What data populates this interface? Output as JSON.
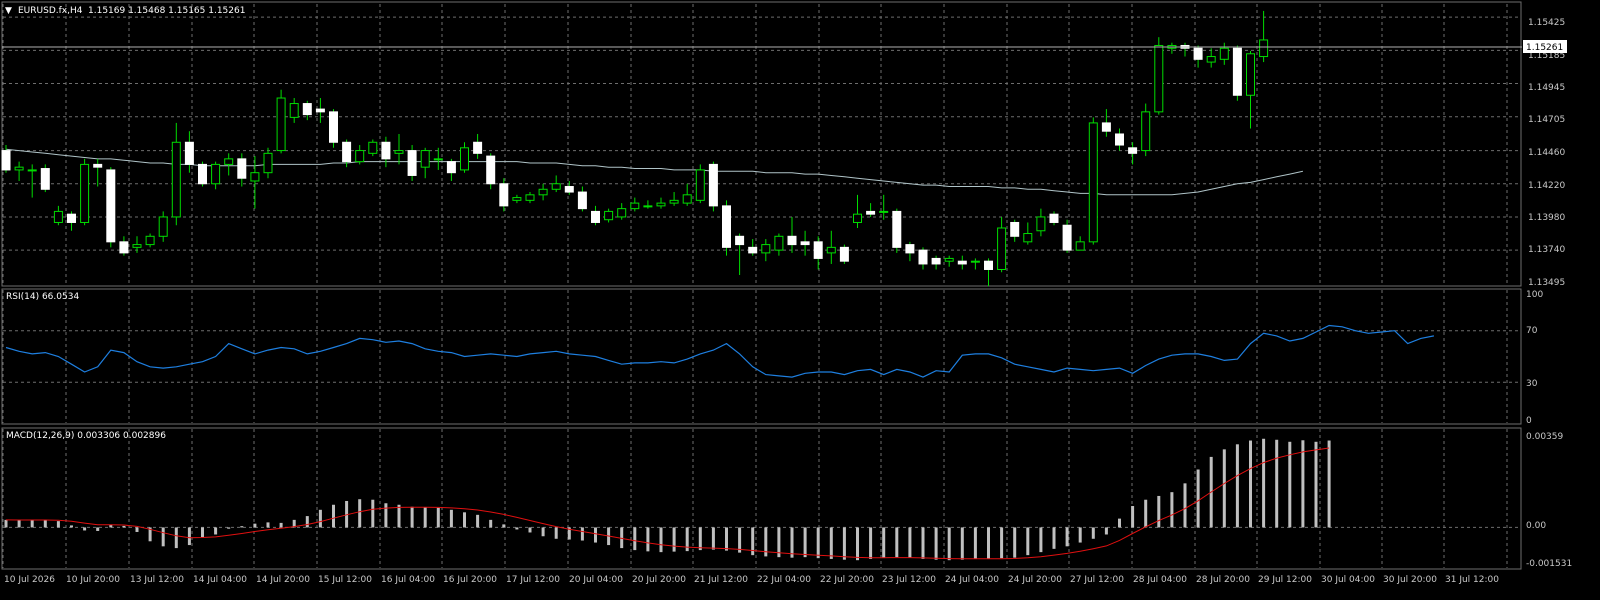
{
  "main": {
    "title_prefix": "▼",
    "symbol": "EURUSD.fx,H4",
    "ohlc": "1.15169 1.15468 1.15165 1.15261",
    "price_axis": [
      "1.15425",
      "1.15185",
      "1.14945",
      "1.14705",
      "1.14460",
      "1.14220",
      "1.13980",
      "1.13740",
      "1.13495"
    ],
    "current_price": "1.15261"
  },
  "rsi": {
    "title": "RSI(14) 66.0534",
    "axis": [
      "100",
      "70",
      "30",
      "0"
    ]
  },
  "macd": {
    "title": "MACD(12,26,9) 0.003306 0.002896",
    "axis": [
      "0.00359",
      "0.00",
      "-0.001531"
    ]
  },
  "time_axis": [
    "10 Jul 2026",
    "10 Jul 20:00",
    "13 Jul 12:00",
    "14 Jul 04:00",
    "14 Jul 20:00",
    "15 Jul 12:00",
    "16 Jul 04:00",
    "16 Jul 20:00",
    "17 Jul 12:00",
    "20 Jul 04:00",
    "20 Jul 20:00",
    "21 Jul 12:00",
    "22 Jul 04:00",
    "22 Jul 20:00",
    "23 Jul 12:00",
    "24 Jul 04:00",
    "24 Jul 20:00",
    "27 Jul 12:00",
    "28 Jul 04:00",
    "28 Jul 20:00",
    "29 Jul 12:00",
    "30 Jul 04:00",
    "30 Jul 20:00",
    "31 Jul 12:00"
  ],
  "colors": {
    "background": "#000000",
    "grid": "#6e6e6e",
    "bull_body": "#000000",
    "bear_body": "#ffffff",
    "wick": "#00dd00",
    "ma": "#b0c4c8",
    "rsi_line": "#1e7fe0",
    "macd_hist": "#c0c0c0",
    "macd_signal": "#e01010",
    "price_box_bg": "#ffffff"
  },
  "chart_data": [
    {
      "type": "candlestick",
      "title": "EURUSD.fx,H4",
      "ylim": [
        1.13495,
        1.1552
      ],
      "moving_average": [
        1.1447,
        1.1446,
        1.1445,
        1.1444,
        1.1443,
        1.1442,
        1.1441,
        1.144,
        1.144,
        1.1439,
        1.1438,
        1.1437,
        1.1437,
        1.1436,
        1.1436,
        1.1435,
        1.1435,
        1.1435,
        1.1435,
        1.1435,
        1.1436,
        1.1436,
        1.1436,
        1.1436,
        1.1436,
        1.1437,
        1.1437,
        1.1438,
        1.1438,
        1.1438,
        1.1438,
        1.1438,
        1.1438,
        1.1438,
        1.1438,
        1.1438,
        1.1438,
        1.1438,
        1.1438,
        1.1438,
        1.1437,
        1.1437,
        1.1437,
        1.1436,
        1.1435,
        1.1435,
        1.1434,
        1.1434,
        1.1433,
        1.1433,
        1.1433,
        1.1432,
        1.1432,
        1.1432,
        1.1431,
        1.1431,
        1.1431,
        1.1431,
        1.143,
        1.143,
        1.143,
        1.1429,
        1.1429,
        1.1428,
        1.1427,
        1.1426,
        1.1425,
        1.1424,
        1.1423,
        1.1422,
        1.1421,
        1.1421,
        1.142,
        1.142,
        1.142,
        1.142,
        1.1419,
        1.1419,
        1.1418,
        1.1418,
        1.1417,
        1.1416,
        1.1415,
        1.1415,
        1.1414,
        1.1414,
        1.1414,
        1.1414,
        1.1414,
        1.1414,
        1.1415,
        1.1416,
        1.1418,
        1.142,
        1.1422,
        1.1423,
        1.1425,
        1.1427,
        1.1429,
        1.1431
      ],
      "candles": [
        [
          1.1446,
          1.1432,
          1.145,
          1.143
        ],
        [
          1.1432,
          1.1434,
          1.1438,
          1.1424
        ],
        [
          1.1432,
          1.1432,
          1.1436,
          1.1412
        ],
        [
          1.1433,
          1.1418,
          1.1436,
          1.1416
        ],
        [
          1.1394,
          1.1402,
          1.1406,
          1.1392
        ],
        [
          1.14,
          1.1394,
          1.1402,
          1.1388
        ],
        [
          1.1394,
          1.1436,
          1.144,
          1.1392
        ],
        [
          1.1436,
          1.1434,
          1.144,
          1.142
        ],
        [
          1.1432,
          1.138,
          1.1434,
          1.1376
        ],
        [
          1.138,
          1.1372,
          1.1384,
          1.137
        ],
        [
          1.1376,
          1.1378,
          1.1384,
          1.1372
        ],
        [
          1.1378,
          1.1384,
          1.1386,
          1.1376
        ],
        [
          1.1384,
          1.1398,
          1.1402,
          1.138
        ],
        [
          1.1398,
          1.1452,
          1.1466,
          1.1392
        ],
        [
          1.1452,
          1.1436,
          1.146,
          1.143
        ],
        [
          1.1436,
          1.1422,
          1.1438,
          1.142
        ],
        [
          1.1422,
          1.1436,
          1.1438,
          1.1418
        ],
        [
          1.1436,
          1.144,
          1.1444,
          1.1428
        ],
        [
          1.144,
          1.1426,
          1.1444,
          1.142
        ],
        [
          1.1424,
          1.143,
          1.1442,
          1.1404
        ],
        [
          1.143,
          1.1444,
          1.1448,
          1.1426
        ],
        [
          1.1446,
          1.1484,
          1.149,
          1.1444
        ],
        [
          1.147,
          1.148,
          1.1484,
          1.1466
        ],
        [
          1.148,
          1.1472,
          1.1482,
          1.1468
        ],
        [
          1.1476,
          1.1474,
          1.1484,
          1.1466
        ],
        [
          1.1474,
          1.1452,
          1.1476,
          1.1448
        ],
        [
          1.1452,
          1.1438,
          1.1454,
          1.1434
        ],
        [
          1.1438,
          1.1446,
          1.145,
          1.1436
        ],
        [
          1.1444,
          1.1452,
          1.1454,
          1.1442
        ],
        [
          1.1452,
          1.144,
          1.1456,
          1.1434
        ],
        [
          1.1444,
          1.1446,
          1.1458,
          1.1436
        ],
        [
          1.1446,
          1.1428,
          1.145,
          1.1424
        ],
        [
          1.1434,
          1.1446,
          1.1448,
          1.1426
        ],
        [
          1.144,
          1.144,
          1.1448,
          1.1432
        ],
        [
          1.1438,
          1.143,
          1.144,
          1.1424
        ],
        [
          1.1432,
          1.1448,
          1.1452,
          1.143
        ],
        [
          1.1452,
          1.1444,
          1.1458,
          1.144
        ],
        [
          1.1442,
          1.1422,
          1.1444,
          1.1418
        ],
        [
          1.1422,
          1.1406,
          1.1426,
          1.1402
        ],
        [
          1.141,
          1.1412,
          1.1414,
          1.1408
        ],
        [
          1.141,
          1.1414,
          1.1416,
          1.1408
        ],
        [
          1.1414,
          1.1418,
          1.1422,
          1.141
        ],
        [
          1.1418,
          1.1422,
          1.1428,
          1.1416
        ],
        [
          1.142,
          1.1416,
          1.1424,
          1.1414
        ],
        [
          1.1416,
          1.1404,
          1.142,
          1.1402
        ],
        [
          1.1402,
          1.1394,
          1.1406,
          1.1392
        ],
        [
          1.1396,
          1.1402,
          1.1404,
          1.1394
        ],
        [
          1.1398,
          1.1404,
          1.1408,
          1.1396
        ],
        [
          1.1404,
          1.1408,
          1.1412,
          1.1402
        ],
        [
          1.1406,
          1.1406,
          1.141,
          1.1404
        ],
        [
          1.1406,
          1.1408,
          1.1412,
          1.1404
        ],
        [
          1.1408,
          1.141,
          1.1416,
          1.1406
        ],
        [
          1.1408,
          1.1414,
          1.1422,
          1.1406
        ],
        [
          1.141,
          1.1432,
          1.1436,
          1.1408
        ],
        [
          1.1436,
          1.1406,
          1.1438,
          1.1402
        ],
        [
          1.1406,
          1.1376,
          1.141,
          1.137
        ],
        [
          1.1384,
          1.1378,
          1.1386,
          1.1356
        ],
        [
          1.1376,
          1.1372,
          1.1382,
          1.137
        ],
        [
          1.1372,
          1.1378,
          1.1382,
          1.1366
        ],
        [
          1.1374,
          1.1384,
          1.1386,
          1.137
        ],
        [
          1.1384,
          1.1378,
          1.1398,
          1.1372
        ],
        [
          1.138,
          1.1378,
          1.1388,
          1.137
        ],
        [
          1.138,
          1.1368,
          1.1384,
          1.136
        ],
        [
          1.1372,
          1.1376,
          1.1388,
          1.1364
        ],
        [
          1.1376,
          1.1366,
          1.1378,
          1.1364
        ],
        [
          1.1394,
          1.14,
          1.1414,
          1.139
        ],
        [
          1.1402,
          1.14,
          1.1408,
          1.1398
        ],
        [
          1.1402,
          1.1402,
          1.1414,
          1.1396
        ],
        [
          1.1402,
          1.1376,
          1.1404,
          1.1372
        ],
        [
          1.1378,
          1.1372,
          1.138,
          1.1366
        ],
        [
          1.1374,
          1.1364,
          1.1376,
          1.136
        ],
        [
          1.1368,
          1.1364,
          1.137,
          1.136
        ],
        [
          1.1366,
          1.1368,
          1.137,
          1.1362
        ],
        [
          1.1366,
          1.1364,
          1.137,
          1.136
        ],
        [
          1.1366,
          1.1366,
          1.1368,
          1.136
        ],
        [
          1.1366,
          1.136,
          1.1368,
          1.1348
        ],
        [
          1.136,
          1.139,
          1.1398,
          1.1358
        ],
        [
          1.1394,
          1.1384,
          1.1396,
          1.138
        ],
        [
          1.138,
          1.1386,
          1.1394,
          1.1378
        ],
        [
          1.1388,
          1.1398,
          1.1404,
          1.1384
        ],
        [
          1.14,
          1.1394,
          1.1402,
          1.1392
        ],
        [
          1.1392,
          1.1374,
          1.1396,
          1.1372
        ],
        [
          1.1374,
          1.138,
          1.1384,
          1.1374
        ],
        [
          1.138,
          1.1466,
          1.147,
          1.1378
        ],
        [
          1.1466,
          1.146,
          1.1476,
          1.1456
        ],
        [
          1.1458,
          1.145,
          1.1462,
          1.1446
        ],
        [
          1.1448,
          1.1444,
          1.1452,
          1.1436
        ],
        [
          1.1446,
          1.1474,
          1.148,
          1.1442
        ],
        [
          1.1474,
          1.1522,
          1.1528,
          1.1472
        ],
        [
          1.152,
          1.1522,
          1.1524,
          1.1516
        ],
        [
          1.1522,
          1.152,
          1.1524,
          1.1514
        ],
        [
          1.152,
          1.1512,
          1.1522,
          1.1506
        ],
        [
          1.151,
          1.1514,
          1.152,
          1.1506
        ],
        [
          1.1512,
          1.152,
          1.1524,
          1.1508
        ],
        [
          1.152,
          1.1486,
          1.1522,
          1.1482
        ],
        [
          1.1486,
          1.1516,
          1.1518,
          1.1462
        ],
        [
          1.1514,
          1.1526,
          1.1547,
          1.151
        ]
      ]
    },
    {
      "type": "line",
      "title": "RSI(14) 66.0534",
      "ylim": [
        0,
        100
      ],
      "values": [
        57,
        54,
        52,
        53,
        50,
        44,
        38,
        42,
        55,
        53,
        46,
        42,
        41,
        42,
        44,
        46,
        50,
        60,
        56,
        52,
        55,
        57,
        56,
        52,
        54,
        57,
        60,
        64,
        63,
        61,
        62,
        60,
        56,
        54,
        53,
        50,
        51,
        52,
        51,
        50,
        52,
        53,
        54,
        52,
        51,
        50,
        47,
        44,
        45,
        45,
        46,
        45,
        48,
        52,
        55,
        60,
        52,
        42,
        36,
        35,
        34,
        37,
        38,
        38,
        36,
        39,
        40,
        36,
        40,
        38,
        34,
        39,
        38,
        51,
        52,
        52,
        49,
        44,
        42,
        40,
        38,
        41,
        40,
        39,
        40,
        41,
        37,
        43,
        48,
        51,
        52,
        52,
        50,
        47,
        48,
        60,
        68,
        66,
        62,
        64,
        69,
        74,
        73,
        70,
        68,
        69,
        70,
        60,
        64,
        66
      ]
    },
    {
      "type": "bar",
      "title": "MACD(12,26,9) 0.003306 0.002896",
      "ylim": [
        -0.001531,
        0.00359
      ],
      "histogram": [
        0.0003,
        0.00028,
        0.0003,
        0.00029,
        0.00025,
        8e-05,
        -0.00012,
        -0.00014,
        0.0001,
        6e-05,
        -0.00018,
        -0.00055,
        -0.00075,
        -0.00082,
        -0.0007,
        -0.00038,
        -0.00028,
        -5e-05,
        5e-05,
        0.00015,
        0.0002,
        0.00018,
        0.0003,
        0.00045,
        0.0007,
        0.0009,
        0.00105,
        0.00112,
        0.0011,
        0.00096,
        0.0009,
        0.00082,
        0.0008,
        0.00078,
        0.0007,
        0.0006,
        0.0005,
        0.0003,
        0.00012,
        -8e-05,
        -0.0002,
        -0.00035,
        -0.00045,
        -0.00048,
        -0.00052,
        -0.0006,
        -0.0007,
        -0.00082,
        -0.0009,
        -0.00095,
        -0.00098,
        -0.00096,
        -0.00094,
        -0.0009,
        -0.00088,
        -0.00092,
        -0.001,
        -0.0011,
        -0.00115,
        -0.00118,
        -0.0012,
        -0.00118,
        -0.00122,
        -0.00125,
        -0.00128,
        -0.0013,
        -0.00125,
        -0.0012,
        -0.00118,
        -0.0012,
        -0.00125,
        -0.00128,
        -0.0013,
        -0.00128,
        -0.00125,
        -0.00124,
        -0.00122,
        -0.0012,
        -0.0011,
        -0.00098,
        -0.00085,
        -0.00075,
        -0.0006,
        -0.00045,
        -0.00028,
        0.00035,
        0.00085,
        0.0011,
        0.00125,
        0.0014,
        0.00175,
        0.0023,
        0.0028,
        0.0031,
        0.0033,
        0.00345,
        0.00352,
        0.00348,
        0.0034,
        0.00346,
        0.0034,
        0.00345
      ]
    }
  ]
}
